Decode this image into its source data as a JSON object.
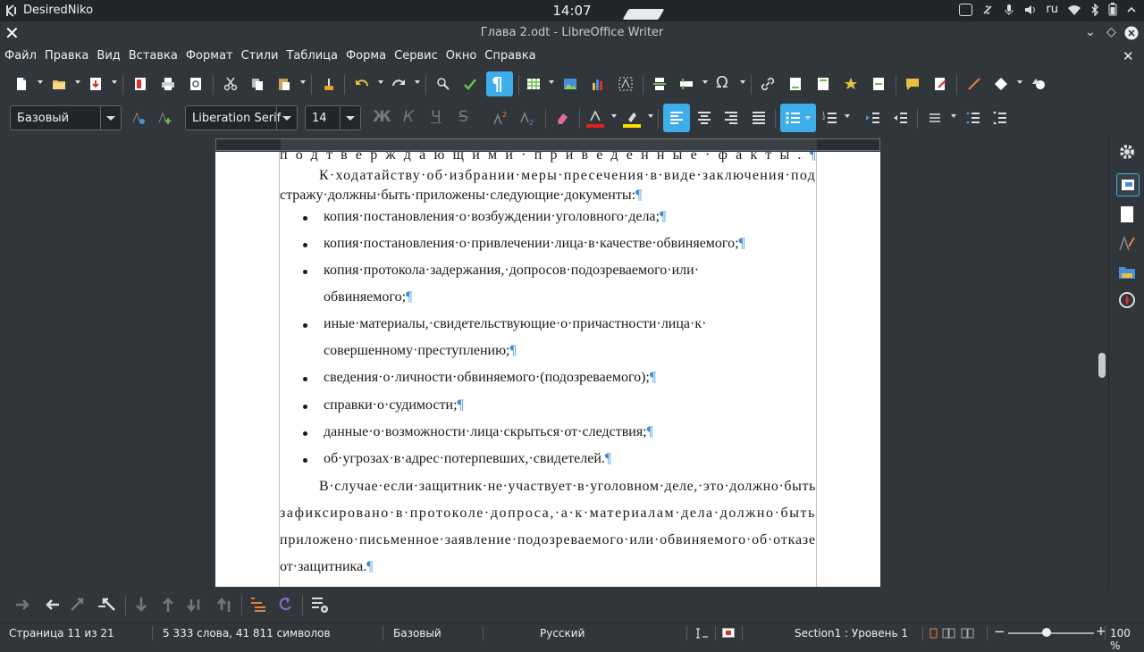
{
  "system": {
    "user": "DesiredNiko",
    "clock": "14:07",
    "keyboard_layout": "ru"
  },
  "window": {
    "title": "Глава 2.odt - LibreOffice Writer"
  },
  "menu": [
    "Файл",
    "Правка",
    "Вид",
    "Вставка",
    "Формат",
    "Стили",
    "Таблица",
    "Форма",
    "Сервис",
    "Окно",
    "Справка"
  ],
  "formatting": {
    "paragraph_style": "Базовый",
    "font_name": "Liberation Serif",
    "font_size": "14"
  },
  "colors": {
    "accent": "#3daee9",
    "font_color": "#e02020",
    "highlight_color": "#ffe000",
    "formatting_mark": "#3b8ed8"
  },
  "document": {
    "pilcrow": "¶",
    "bullet_marker": "•",
    "lines": [
      {
        "text": "подтверждающими·приведенные·факты.",
        "pm": true,
        "indent": "none"
      },
      {
        "text": "К·ходатайству·об·избрании·меры·пресечения·в·виде·заключения·под",
        "pm": false,
        "indent": "first"
      },
      {
        "text": "стражу·должны·быть·приложены·следующие·документы:",
        "pm": true,
        "indent": "none"
      },
      {
        "text": "копия·постановления·о·возбуждении·уголовного·дела;",
        "pm": true,
        "indent": "bullet"
      },
      {
        "text": "копия·постановления·о·привлечении·лица·в·качестве·обвиняемого;",
        "pm": true,
        "indent": "bullet"
      },
      {
        "text": "копия·протокола·задержания,·допросов·подозреваемого·или·",
        "pm": false,
        "indent": "bullet"
      },
      {
        "text": "обвиняемого;",
        "pm": true,
        "indent": "bullet-cont"
      },
      {
        "text": "иные·материалы,·свидетельствующие·о·причастности·лица·к·",
        "pm": false,
        "indent": "bullet"
      },
      {
        "text": "совершенному·преступлению;",
        "pm": true,
        "indent": "bullet-cont"
      },
      {
        "text": "сведения·о·личности·обвиняемого·(подозреваемого);",
        "pm": true,
        "indent": "bullet"
      },
      {
        "text": "справки·о·судимости;",
        "pm": true,
        "indent": "bullet"
      },
      {
        "text": "данные·о·возможности·лица·скрыться·от·следствия;",
        "pm": true,
        "indent": "bullet"
      },
      {
        "text": "об·угрозах·в·адрес·потерпевших,·свидетелей.",
        "pm": true,
        "indent": "bullet"
      },
      {
        "text": "В·случае·если·защитник·не·участвует·в·уголовном·деле,·это·должно·быть",
        "pm": false,
        "indent": "first"
      },
      {
        "text": "зафиксировано·в·протоколе·допроса,·а·к·материалам·дела·должно·быть",
        "pm": false,
        "indent": "none"
      },
      {
        "text": "приложено·письменное·заявление·подозреваемого·или·обвиняемого·об·отказе",
        "pm": false,
        "indent": "none"
      },
      {
        "text": "от·защитника.",
        "pm": true,
        "indent": "none"
      }
    ]
  },
  "status": {
    "page": "Страница 11 из 21",
    "words": "5 333 слова, 41 811 символов",
    "page_style": "Базовый",
    "language": "Русский",
    "section": "Section1 : Уровень 1",
    "zoom": "100 %"
  }
}
